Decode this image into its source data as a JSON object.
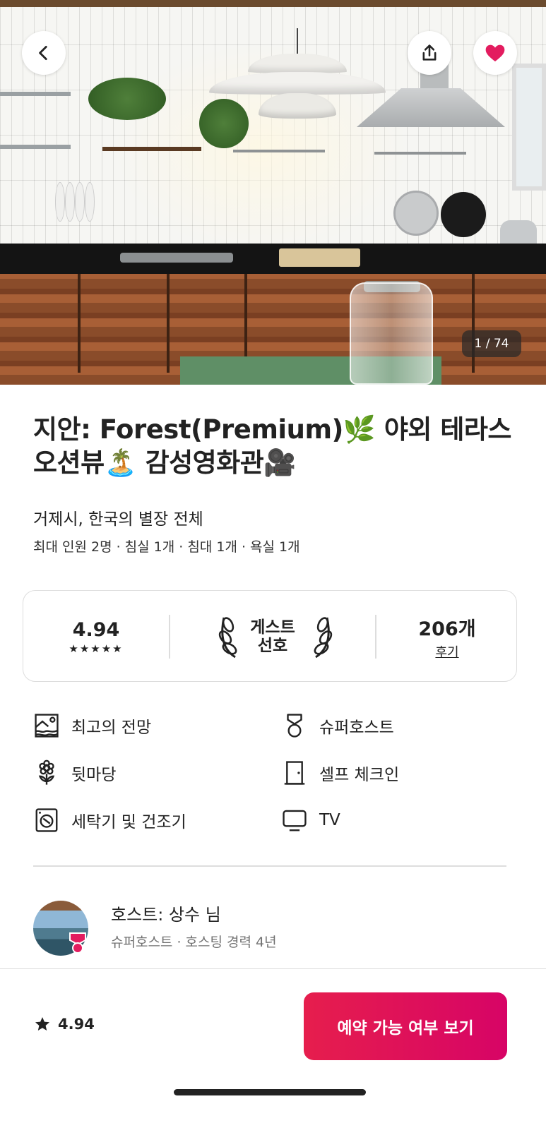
{
  "hero": {
    "photo_counter": "1 / 74",
    "back_icon": "chevron-left-icon",
    "share_icon": "share-icon",
    "save_icon": "heart-icon",
    "heart_color": "#E31C5F"
  },
  "listing": {
    "title": "지안: Forest(Premium)🌿 야외 테라스 오션뷰🏝️ 감성영화관🎥",
    "subtitle": "거제시, 한국의 별장 전체",
    "details": "최대 인원 2명 · 침실 1개 · 침대 1개 · 욕실 1개"
  },
  "rating_card": {
    "rating": "4.94",
    "stars": "★★★★★",
    "guest_favorite_line1": "게스트",
    "guest_favorite_line2": "선호",
    "review_count": "206개",
    "review_label": "후기"
  },
  "amenities": [
    {
      "label": "최고의 전망",
      "icon": "landscape-icon"
    },
    {
      "label": "슈퍼호스트",
      "icon": "medal-icon"
    },
    {
      "label": "뒷마당",
      "icon": "flower-icon"
    },
    {
      "label": "셀프 체크인",
      "icon": "door-icon"
    },
    {
      "label": "세탁기 및 건조기",
      "icon": "washer-icon"
    },
    {
      "label": "TV",
      "icon": "tv-icon"
    }
  ],
  "host": {
    "name": "호스트: 상수 님",
    "subtitle": "슈퍼호스트 · 호스팅 경력 4년"
  },
  "footer": {
    "rating": "4.94",
    "reserve_label": "예약 가능 여부 보기",
    "accent_color": "#E61E4D"
  }
}
